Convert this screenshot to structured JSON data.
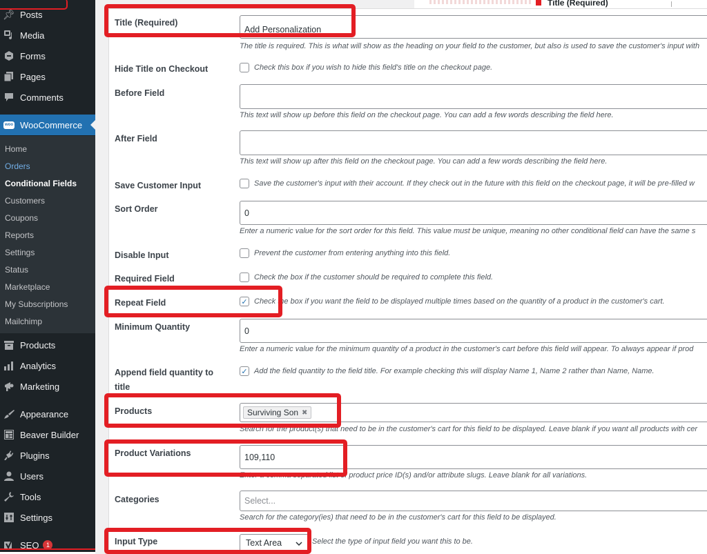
{
  "sidebar": {
    "top_items": [
      {
        "label": "Posts",
        "icon": "pin-icon"
      },
      {
        "label": "Media",
        "icon": "media-icon"
      },
      {
        "label": "Forms",
        "icon": "forms-icon"
      },
      {
        "label": "Pages",
        "icon": "pages-icon"
      },
      {
        "label": "Comments",
        "icon": "comment-icon"
      }
    ],
    "woocommerce": {
      "label": "WooCommerce",
      "logo": "woo"
    },
    "submenu": [
      {
        "label": "Home"
      },
      {
        "label": "Orders"
      },
      {
        "label": "Conditional Fields"
      },
      {
        "label": "Customers"
      },
      {
        "label": "Coupons"
      },
      {
        "label": "Reports"
      },
      {
        "label": "Settings"
      },
      {
        "label": "Status"
      },
      {
        "label": "Marketplace"
      },
      {
        "label": "My Subscriptions"
      },
      {
        "label": "Mailchimp"
      }
    ],
    "bottom_items": [
      {
        "label": "Products",
        "icon": "archive-icon"
      },
      {
        "label": "Analytics",
        "icon": "bar-chart-icon"
      },
      {
        "label": "Marketing",
        "icon": "megaphone-icon"
      },
      {
        "label": "Appearance",
        "icon": "paintbrush-icon"
      },
      {
        "label": "Beaver Builder",
        "icon": "layout-icon"
      },
      {
        "label": "Plugins",
        "icon": "plug-icon"
      },
      {
        "label": "Users",
        "icon": "user-icon"
      },
      {
        "label": "Tools",
        "icon": "wrench-icon"
      },
      {
        "label": "Settings",
        "icon": "sliders-icon"
      },
      {
        "label": "SEO",
        "icon": "yoast-icon",
        "badge": "1"
      }
    ]
  },
  "top_strip": {
    "title": "Title (Required)"
  },
  "form": {
    "title": {
      "label": "Title (Required)",
      "value": "Add Personalization",
      "desc": "The title is required. This is what will show as the heading on your field to the customer, but also is used to save the customer's input with"
    },
    "hide_title": {
      "label": "Hide Title on Checkout",
      "checked": false,
      "text": "Check this box if you wish to hide this field's title on the checkout page."
    },
    "before_field": {
      "label": "Before Field",
      "value": "",
      "desc": "This text will show up before this field on the checkout page. You can add a few words describing the field here."
    },
    "after_field": {
      "label": "After Field",
      "value": "",
      "desc": "This text will show up after this field on the checkout page. You can add a few words describing the field here."
    },
    "save_input": {
      "label": "Save Customer Input",
      "checked": false,
      "text": "Save the customer's input with their account. If they check out in the future with this field on the checkout page, it will be pre-filled w"
    },
    "sort_order": {
      "label": "Sort Order",
      "value": "0",
      "desc": "Enter a numeric value for the sort order for this field. This value must be unique, meaning no other conditional field can have the same s"
    },
    "disable_input": {
      "label": "Disable Input",
      "checked": false,
      "text": "Prevent the customer from entering anything into this field."
    },
    "required_field": {
      "label": "Required Field",
      "checked": false,
      "text": "Check the box if the customer should be required to complete this field."
    },
    "repeat_field": {
      "label": "Repeat Field",
      "checked": true,
      "check_glyph": "✓",
      "text": "Check the box if you want the field to be displayed multiple times based on the quantity of a product in the customer's cart."
    },
    "min_quantity": {
      "label": "Minimum Quantity",
      "value": "0",
      "desc": "Enter a numeric value for the minimum quantity of a product in the customer's cart before this field will appear. To always appear if prod"
    },
    "append_qty": {
      "label_line1": "Append field quantity to",
      "label_line2": "title",
      "checked": true,
      "check_glyph": "✓",
      "text": "Add the field quantity to the field title. For example checking this will display Name 1, Name 2 rather than Name, Name."
    },
    "products": {
      "label": "Products",
      "tokens": [
        {
          "label": "Surviving Son",
          "remove": "✖"
        }
      ],
      "desc": "Search for the product(s) that need to be in the customer's cart for this field to be displayed. Leave blank if you want all products with cer"
    },
    "product_variations": {
      "label": "Product Variations",
      "value": "109,110",
      "desc": "Enter a comma separated list of product price ID(s) and/or attribute slugs. Leave blank for all variations."
    },
    "categories": {
      "label": "Categories",
      "placeholder": "Select...",
      "desc": "Search for the category(ies) that need to be in the customer's cart for this field to be displayed."
    },
    "input_type": {
      "label": "Input Type",
      "selected": "Text Area",
      "chevron": "⌄",
      "desc": "Select the type of input field you want this to be."
    }
  },
  "annotation_color": "#e31e24"
}
